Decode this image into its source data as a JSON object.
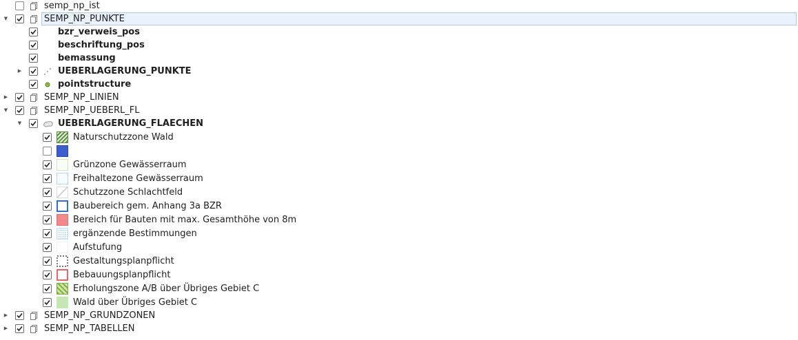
{
  "tree": {
    "semp_np_ist": "semp_np_ist",
    "punkte": {
      "label": "SEMP_NP_PUNKTE",
      "children": [
        "bzr_verweis_pos",
        "beschriftung_pos",
        "bemassung",
        "UEBERLAGERUNG_PUNKTE",
        "pointstructure"
      ]
    },
    "linien": "SEMP_NP_LINIEN",
    "ueberl_fl": {
      "label": "SEMP_NP_UEBERL_FL",
      "layer": "UEBERLAGERUNG_FLAECHEN",
      "classes": [
        "Naturschutzzone Wald",
        "",
        "Grünzone Gewässerraum",
        "Freihaltezone Gewässerraum",
        "Schutzzone Schlachtfeld",
        "Baubereich gem. Anhang 3a BZR",
        "Bereich für Bauten mit max. Gesamthöhe von 8m",
        "ergänzende Bestimmungen",
        "Aufstufung",
        "Gestaltungsplanpflicht",
        "Bebauungsplanpflicht",
        "Erholungszone A/B über Übriges Gebiet C",
        "Wald über Übriges Gebiet C"
      ]
    },
    "grundzonen": "SEMP_NP_GRUNDZONEN",
    "tabellen": "SEMP_NP_TABELLEN"
  },
  "colors": {
    "selection": "#eaf3fb",
    "blue_fill": "#3a5fcd",
    "pink_fill": "#f08a8a",
    "green_fill": "#c6e6b3",
    "point_green": "#8fbf3f"
  },
  "icons": {
    "group": "group-layers-icon",
    "point": "point-layer-icon",
    "polygon": "polygon-layer-icon"
  }
}
